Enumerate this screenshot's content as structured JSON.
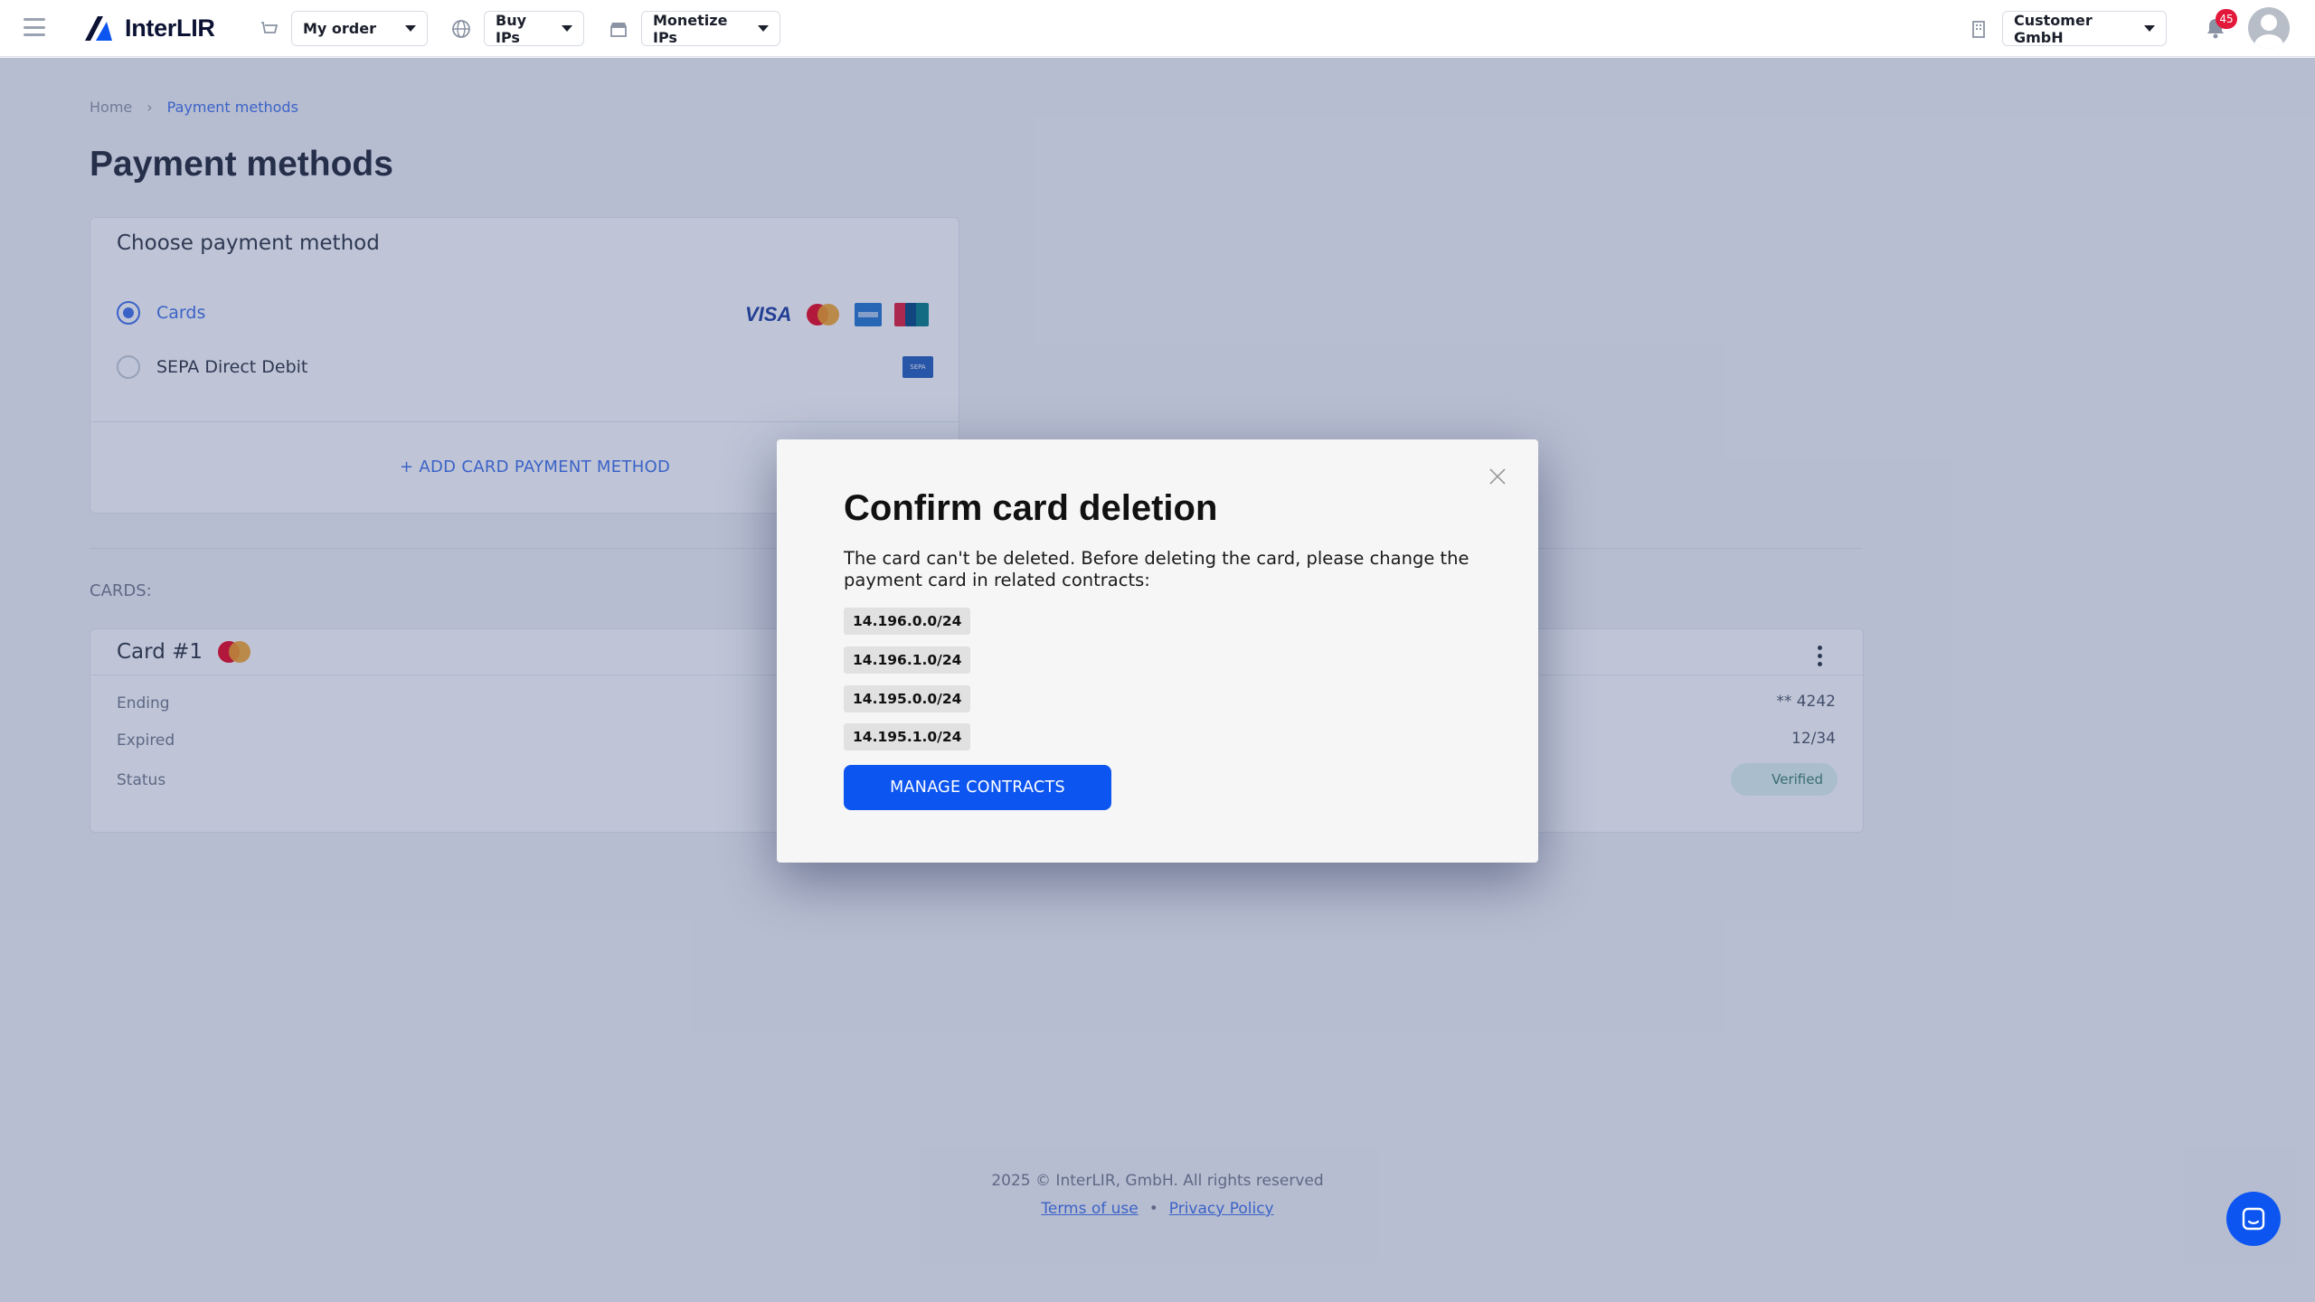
{
  "topbar": {
    "brand": "InterLIR",
    "my_order": "My order",
    "buy_ips": "Buy IPs",
    "monetize_ips": "Monetize IPs",
    "company": "Customer GmbH",
    "notifications_count": "45"
  },
  "breadcrumb": {
    "home": "Home",
    "current": "Payment methods"
  },
  "page_title": "Payment methods",
  "payment": {
    "heading": "Choose payment method",
    "options": [
      {
        "label": "Cards",
        "selected": true
      },
      {
        "label": "SEPA Direct Debit",
        "selected": false
      }
    ],
    "add_card": "+  ADD CARD PAYMENT METHOD",
    "brand_visa": "VISA",
    "sepa_badge": "SEPA"
  },
  "cards_section": {
    "label": "CARDS:",
    "card_title": "Card #1",
    "rows": [
      {
        "key": "Ending",
        "value": "** 4242"
      },
      {
        "key": "Expired",
        "value": "12/34"
      },
      {
        "key": "Status",
        "value": "Verified"
      }
    ]
  },
  "modal": {
    "title": "Confirm card deletion",
    "message": "The card can't be deleted. Before deleting the card, please change the payment card in related contracts:",
    "subnets": [
      "14.196.0.0/24",
      "14.196.1.0/24",
      "14.195.0.0/24",
      "14.195.1.0/24"
    ],
    "button": "MANAGE CONTRACTS"
  },
  "footer": {
    "copyright": "2025 © InterLIR, GmbH. All rights reserved",
    "terms": "Terms of use",
    "separator": "•",
    "privacy": "Privacy Policy"
  },
  "colors": {
    "primary": "#0c55f0",
    "link": "#3d6ee8",
    "badge": "#e2193b",
    "overlay": "rgba(55,75,130,0.32)"
  }
}
